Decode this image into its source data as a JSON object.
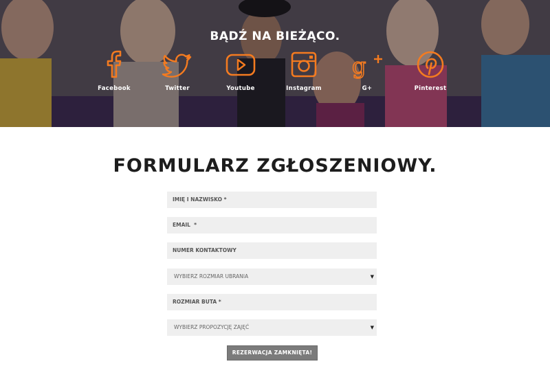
{
  "hero": {
    "title": "BĄDŹ NA BIEŻĄCO.",
    "accent_color": "#f47b20",
    "social": [
      {
        "label": "Facebook",
        "icon": "facebook-icon"
      },
      {
        "label": "Twitter",
        "icon": "twitter-icon"
      },
      {
        "label": "Youtube",
        "icon": "youtube-icon"
      },
      {
        "label": "Instagram",
        "icon": "instagram-icon"
      },
      {
        "label": "G+",
        "icon": "google-plus-icon"
      },
      {
        "label": "Pinterest",
        "icon": "pinterest-icon"
      }
    ]
  },
  "form": {
    "title": "FORMULARZ ZGŁOSZENIOWY.",
    "fields": {
      "name_placeholder": "IMIĘ I NAZWISKO *",
      "email_placeholder": "EMAIL  *",
      "phone_placeholder": "NUMER KONTAKTOWY",
      "clothing_size_selected": "WYBIERZ ROZMIAR UBRANIA",
      "shoe_size_placeholder": "ROZMIAR BUTA *",
      "class_selected": "WYBIERZ PROPOZYCJĘ ZAJĘĆ"
    },
    "submit_label": "REZERWACJA ZAMKNIĘTA!"
  }
}
